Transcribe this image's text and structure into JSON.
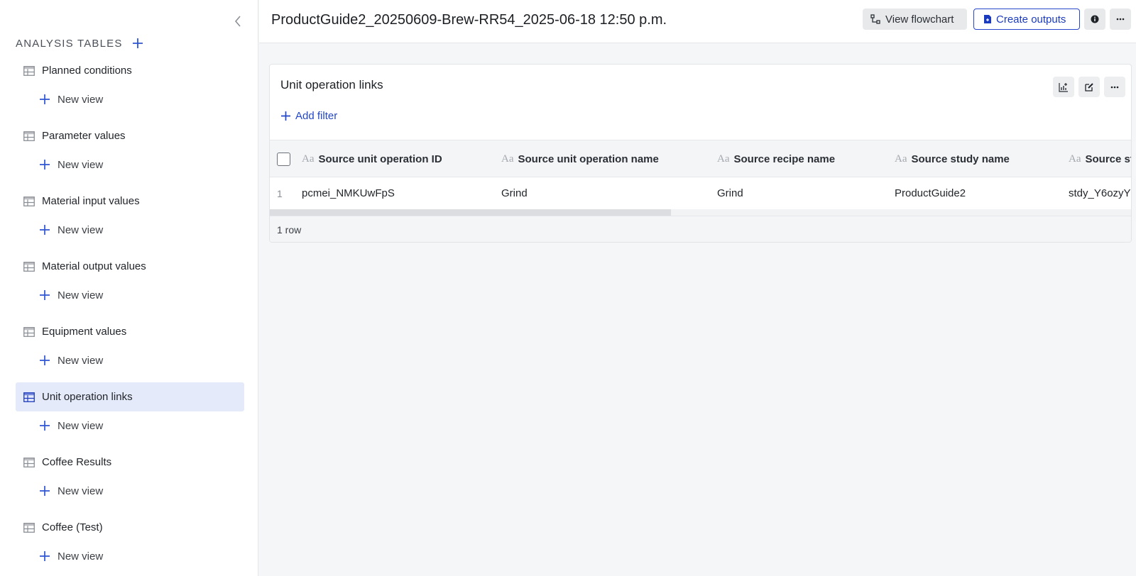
{
  "sidebar": {
    "title": "ANALYSIS TABLES",
    "new_view_label": "New view",
    "items": [
      {
        "label": "Planned conditions",
        "active": false
      },
      {
        "label": "Parameter values",
        "active": false
      },
      {
        "label": "Material input values",
        "active": false
      },
      {
        "label": "Material output values",
        "active": false
      },
      {
        "label": "Equipment values",
        "active": false
      },
      {
        "label": "Unit operation links",
        "active": true
      },
      {
        "label": "Coffee Results",
        "active": false
      },
      {
        "label": "Coffee (Test)",
        "active": false
      }
    ]
  },
  "header": {
    "title": "ProductGuide2_20250609-Brew-RR54_2025-06-18 12:50 p.m.",
    "view_flowchart": "View flowchart",
    "create_outputs": "Create outputs"
  },
  "card": {
    "title": "Unit operation links",
    "add_filter": "Add filter",
    "type_glyph": "Aa",
    "columns": [
      "Source unit operation ID",
      "Source unit operation name",
      "Source recipe name",
      "Source study name",
      "Source st"
    ],
    "rows": [
      {
        "num": "1",
        "cells": [
          "pcmei_NMKUwFpS",
          "Grind",
          "Grind",
          "ProductGuide2",
          "stdy_Y6ozyY"
        ]
      }
    ],
    "row_count": "1 row"
  },
  "colors": {
    "accent": "#2446c9",
    "active_bg": "#e5eafb",
    "button_bg": "#e8e9eb"
  }
}
